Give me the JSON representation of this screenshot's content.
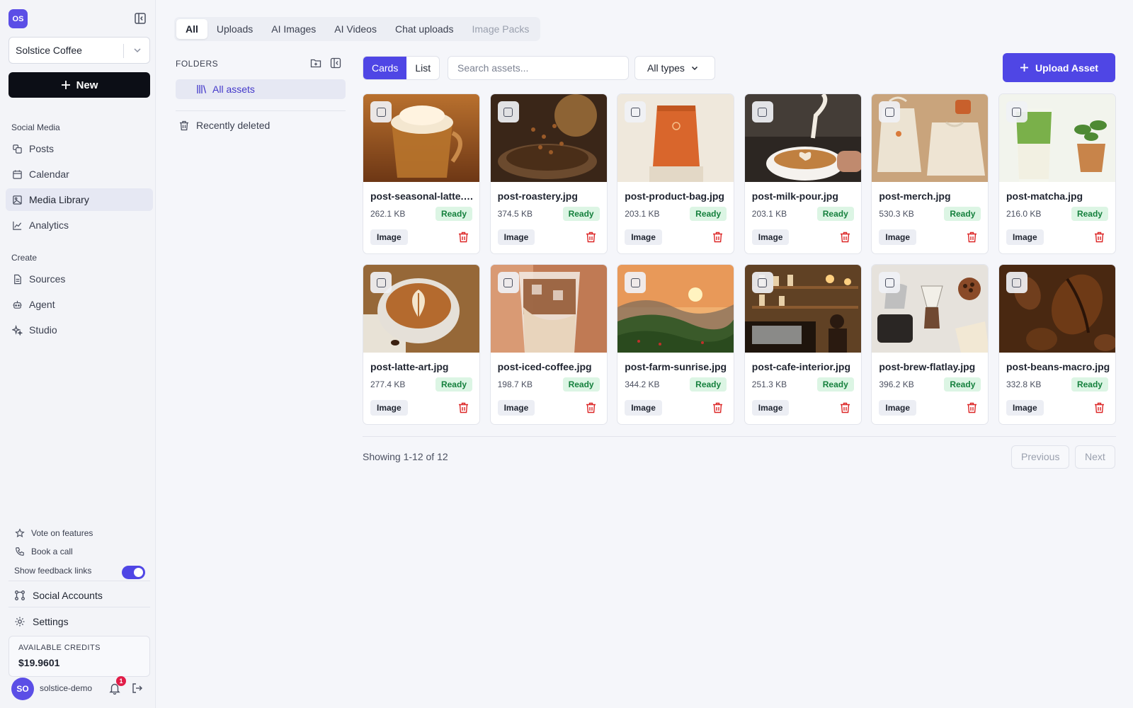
{
  "workspace": {
    "logo_initials": "OS",
    "name": "Solstice Coffee"
  },
  "sidebar": {
    "new_label": "New",
    "sections": {
      "social": "Social Media",
      "create": "Create"
    },
    "social_items": [
      "Posts",
      "Calendar",
      "Media Library",
      "Analytics"
    ],
    "create_items": [
      "Sources",
      "Agent",
      "Studio"
    ],
    "active_item": "Media Library",
    "footer": {
      "vote": "Vote on features",
      "call": "Book a call",
      "feedback_toggle": "Show feedback links",
      "feedback_enabled": true,
      "social_accounts": "Social Accounts",
      "settings": "Settings"
    },
    "credits": {
      "label": "AVAILABLE CREDITS",
      "value": "$19.9601"
    },
    "user": {
      "initials": "SO",
      "name": "solstice-demo",
      "notifications": "1"
    }
  },
  "tabs": [
    "All",
    "Uploads",
    "AI Images",
    "AI Videos",
    "Chat uploads",
    "Image Packs"
  ],
  "active_tab": "All",
  "folders": {
    "title": "FOLDERS",
    "all_assets": "All assets",
    "recently_deleted": "Recently deleted"
  },
  "toolbar": {
    "view_cards": "Cards",
    "view_list": "List",
    "active_view": "Cards",
    "search_placeholder": "Search assets...",
    "type_filter": "All types",
    "upload_label": "Upload Asset"
  },
  "assets": [
    {
      "name": "post-seasonal-latte.jpg",
      "size": "262.1 KB",
      "status": "Ready",
      "kind": "Image"
    },
    {
      "name": "post-roastery.jpg",
      "size": "374.5 KB",
      "status": "Ready",
      "kind": "Image"
    },
    {
      "name": "post-product-bag.jpg",
      "size": "203.1 KB",
      "status": "Ready",
      "kind": "Image"
    },
    {
      "name": "post-milk-pour.jpg",
      "size": "203.1 KB",
      "status": "Ready",
      "kind": "Image"
    },
    {
      "name": "post-merch.jpg",
      "size": "530.3 KB",
      "status": "Ready",
      "kind": "Image"
    },
    {
      "name": "post-matcha.jpg",
      "size": "216.0 KB",
      "status": "Ready",
      "kind": "Image"
    },
    {
      "name": "post-latte-art.jpg",
      "size": "277.4 KB",
      "status": "Ready",
      "kind": "Image"
    },
    {
      "name": "post-iced-coffee.jpg",
      "size": "198.7 KB",
      "status": "Ready",
      "kind": "Image"
    },
    {
      "name": "post-farm-sunrise.jpg",
      "size": "344.2 KB",
      "status": "Ready",
      "kind": "Image"
    },
    {
      "name": "post-cafe-interior.jpg",
      "size": "251.3 KB",
      "status": "Ready",
      "kind": "Image"
    },
    {
      "name": "post-brew-flatlay.jpg",
      "size": "396.2 KB",
      "status": "Ready",
      "kind": "Image"
    },
    {
      "name": "post-beans-macro.jpg",
      "size": "332.8 KB",
      "status": "Ready",
      "kind": "Image"
    }
  ],
  "pagination": {
    "summary": "Showing 1-12 of 12",
    "previous": "Previous",
    "next": "Next"
  },
  "colors": {
    "accent": "#4f46e5",
    "ready_bg": "#dcf5e4",
    "ready_text": "#15803d",
    "danger": "#dc2626"
  }
}
